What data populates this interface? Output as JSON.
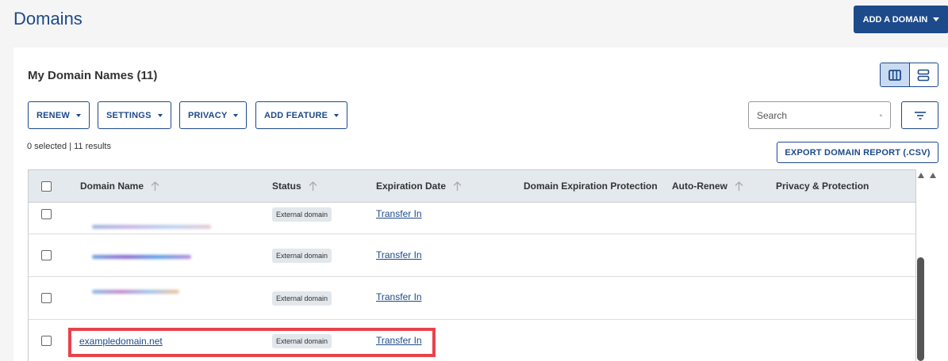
{
  "header": {
    "title": "Domains",
    "add_domain_label": "ADD A DOMAIN"
  },
  "card": {
    "title": "My Domain Names (11)"
  },
  "toolbar": {
    "renew_label": "RENEW",
    "settings_label": "SETTINGS",
    "privacy_label": "PRIVACY",
    "add_feature_label": "ADD FEATURE"
  },
  "search": {
    "placeholder": "Search"
  },
  "selection_info": "0 selected | 11 results",
  "export_label": "EXPORT DOMAIN REPORT (.CSV)",
  "table": {
    "columns": [
      "Domain Name",
      "Status",
      "Expiration Date",
      "Domain Expiration Protection",
      "Auto-Renew",
      "Privacy & Protection"
    ],
    "rows": [
      {
        "domain": "",
        "status": "External domain",
        "expiration": "Transfer In"
      },
      {
        "domain": "",
        "status": "External domain",
        "expiration": "Transfer In"
      },
      {
        "domain": "",
        "status": "External domain",
        "expiration": "Transfer In"
      },
      {
        "domain": "exampledomain.net",
        "status": "External domain",
        "expiration": "Transfer In"
      }
    ]
  },
  "colors": {
    "brand": "#1d4a8a",
    "highlight": "#e8424a",
    "header_bg": "#e4e9ee"
  },
  "icons": [
    "caret-down-icon",
    "column-view-icon",
    "row-view-icon",
    "search-icon",
    "filter-icon",
    "sort-arrow-icon",
    "checkbox-icon"
  ]
}
